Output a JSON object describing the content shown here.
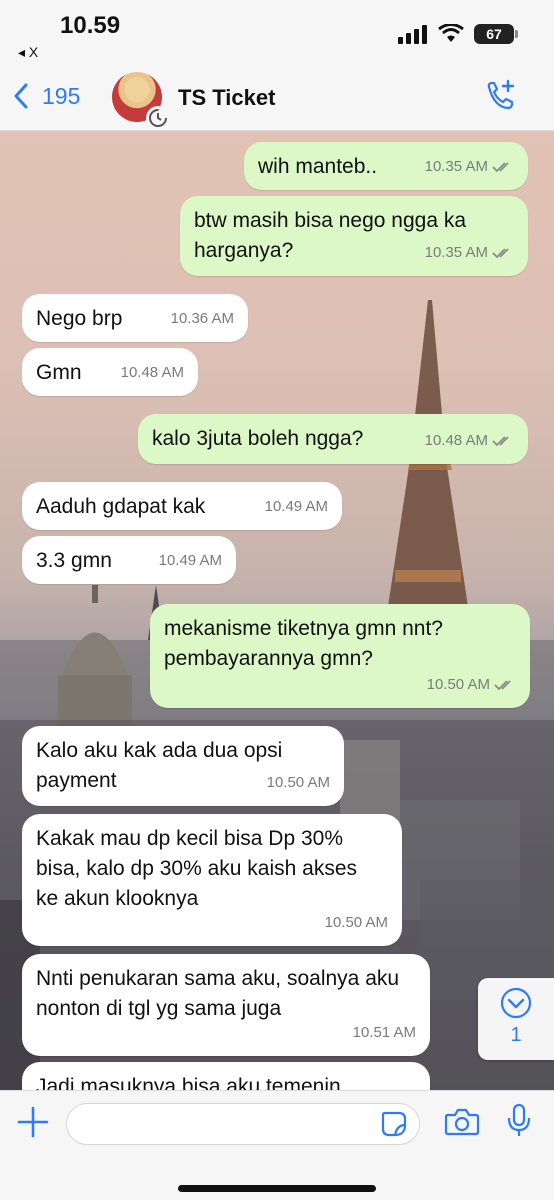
{
  "status_bar": {
    "time": "10.59",
    "back_app": "◂ X",
    "battery": "67"
  },
  "header": {
    "back_count": "195",
    "title": "TS Ticket"
  },
  "messages": [
    {
      "dir": "out",
      "text": "wih manteb..",
      "time": "10.35 AM"
    },
    {
      "dir": "out",
      "text": "btw masih bisa nego ngga ka harganya?",
      "time": "10.35 AM"
    },
    {
      "dir": "in",
      "text": "Nego brp",
      "time": "10.36 AM"
    },
    {
      "dir": "in",
      "text": "Gmn",
      "time": "10.48 AM"
    },
    {
      "dir": "out",
      "text": "kalo 3juta boleh ngga?",
      "time": "10.48 AM"
    },
    {
      "dir": "in",
      "text": "Aaduh gdapat kak",
      "time": "10.49 AM"
    },
    {
      "dir": "in",
      "text": "3.3 gmn",
      "time": "10.49 AM"
    },
    {
      "dir": "out",
      "text": "mekanisme tiketnya gmn nnt? pembayarannya gmn?",
      "time": "10.50 AM"
    },
    {
      "dir": "in",
      "text": "Kalo aku kak ada dua opsi payment",
      "time": "10.50 AM"
    },
    {
      "dir": "in",
      "text": "Kakak mau dp kecil bisa Dp 30% bisa, kalo dp 30% aku kaish akses ke akun klooknya",
      "time": "10.50 AM"
    },
    {
      "dir": "in",
      "text": "Nnti penukaran sama aku, soalnya aku nonton di tgl yg sama juga",
      "time": "10.51 AM"
    },
    {
      "dir": "in",
      "text": "Jadi masuknya bisa aku temenin",
      "time": ""
    }
  ],
  "scroll_down": {
    "unread_count": "1"
  },
  "composer": {
    "placeholder": ""
  },
  "colors": {
    "accent": "#2f7bf5",
    "outgoing_bubble": "#dcf8c6",
    "incoming_bubble": "#ffffff",
    "ticks": "#8a8a8a"
  }
}
